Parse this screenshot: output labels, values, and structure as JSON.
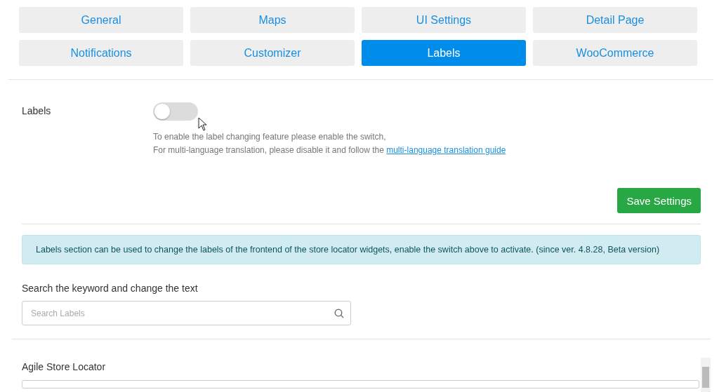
{
  "tabs": [
    {
      "label": "General",
      "selected": false
    },
    {
      "label": "Maps",
      "selected": false
    },
    {
      "label": "UI Settings",
      "selected": false
    },
    {
      "label": "Detail Page",
      "selected": false
    },
    {
      "label": "Notifications",
      "selected": false
    },
    {
      "label": "Customizer",
      "selected": false
    },
    {
      "label": "Labels",
      "selected": true
    },
    {
      "label": "WooCommerce",
      "selected": false
    }
  ],
  "labels_setting": {
    "label": "Labels",
    "on": false,
    "help_line_1": "To enable the label changing feature please enable the switch,",
    "help_line_2": "For multi-language translation, please disable it and follow the ",
    "help_link": "multi-language translation guide"
  },
  "save_button": "Save Settings",
  "info": "Labels section can be used to change the labels of the frontend of the store locator widgets, enable the switch above to activate. (since ver. 4.8.28, Beta version)",
  "search": {
    "label": "Search the keyword and change the text",
    "placeholder": "Search Labels"
  },
  "section": {
    "title": "Agile Store Locator"
  }
}
